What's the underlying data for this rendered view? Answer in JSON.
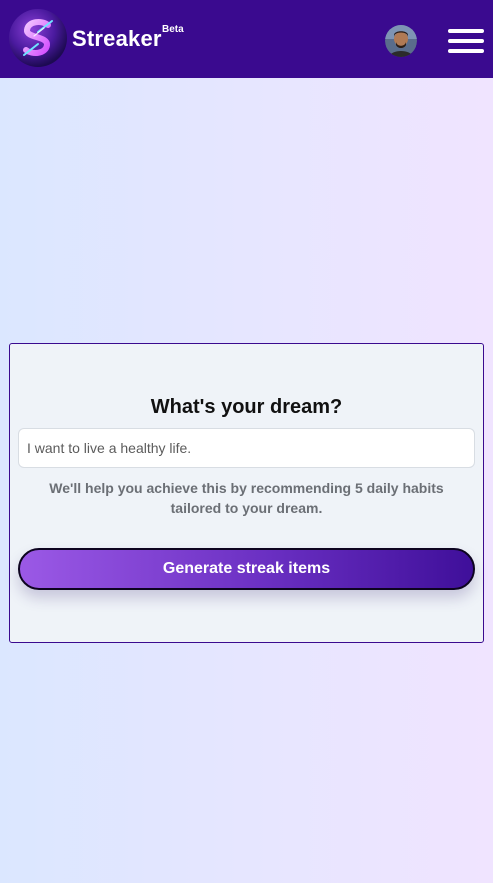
{
  "header": {
    "app_name": "Streaker",
    "badge": "Beta",
    "logo_icon": "streaker-s-logo",
    "avatar_icon": "user-avatar",
    "menu_icon": "hamburger-menu-icon",
    "background_color": "#3a0a8f"
  },
  "dream_form": {
    "title": "What's your dream?",
    "input_placeholder": "I want to live a healthy life.",
    "input_value": "",
    "helper_text": "We'll help you achieve this by recommending 5 daily habits tailored to your dream.",
    "submit_label": "Generate streak items"
  },
  "colors": {
    "brand": "#3a0a8f",
    "button_gradient_start": "#9b59e6",
    "button_gradient_end": "#3f0f9a",
    "card_background": "#eff3f8"
  }
}
